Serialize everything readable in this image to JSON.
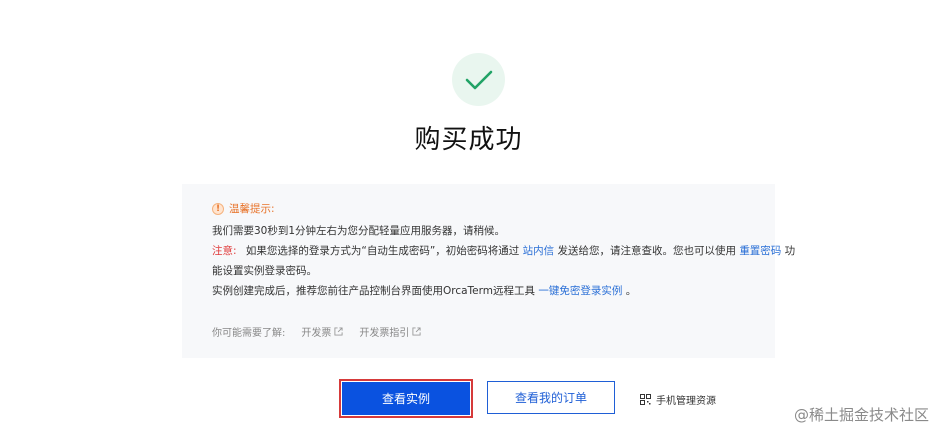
{
  "header": {
    "title": "购买成功",
    "success_icon": "check-icon"
  },
  "notice": {
    "heading": "温馨提示:",
    "line1": "我们需要30秒到1分钟左右为您分配轻量应用服务器，请稍候。",
    "note_label": "注意:",
    "line2_a": "如果您选择的登录方式为“自动生成密码”，初始密码将通过",
    "line2_link": "站内信",
    "line2_b": "发送给您，请注意查收。您也可以使用",
    "line2_link2": "重置密码",
    "line2_c": "功",
    "line3": "能设置实例登录密码。",
    "line4_a": "实例创建完成后，推荐您前往产品控制台界面使用OrcaTerm远程工具",
    "line4_link": "一键免密登录实例",
    "line4_b": "。",
    "maybe_label": "你可能需要了解:",
    "maybe_items": [
      "开发票",
      "开发票指引"
    ]
  },
  "actions": {
    "primary": "查看实例",
    "secondary": "查看我的订单",
    "mobile": "手机管理资源"
  },
  "watermark": "@稀土掘金技术社区",
  "colors": {
    "primary": "#0a52e0",
    "success": "#21a366",
    "warning": "#e8742b",
    "link": "#2a6fd6",
    "alert": "#e03a3a"
  }
}
